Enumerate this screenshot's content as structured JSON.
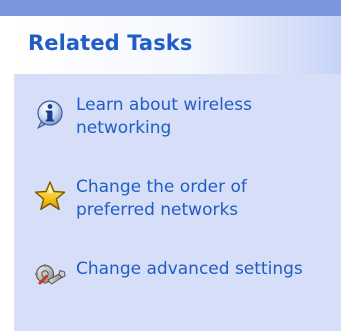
{
  "panel": {
    "title": "Related Tasks",
    "tasks": [
      {
        "icon": "info-icon",
        "label": "Learn about wireless networking"
      },
      {
        "icon": "star-icon",
        "label": "Change the order of preferred networks"
      },
      {
        "icon": "settings-wrench-icon",
        "label": "Change advanced settings"
      }
    ]
  },
  "colors": {
    "accent_strip": "#7a96df",
    "panel_background": "#d6dff7",
    "title_text": "#215dc6",
    "link_text": "#215dc6"
  }
}
